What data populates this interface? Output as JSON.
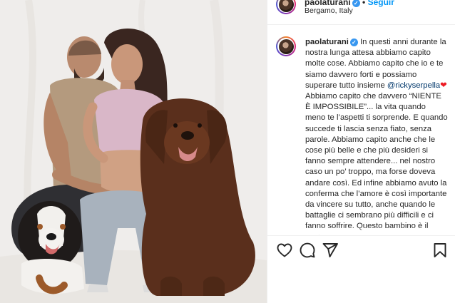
{
  "post": {
    "username": "paolaturani",
    "follow_label": "Seguir",
    "location": "Bergamo, Italy",
    "separator": "•",
    "verified_mark": "✓"
  },
  "caption": {
    "username": "paolaturani",
    "text_1": "In questi anni durante la nostra lunga attesa abbiamo capito molte cose. Abbiamo capito che io e te siamo davvero forti e possiamo superare tutto insieme ",
    "mention": "@rickyserpella",
    "heart": "❤",
    "text_2": " Abbiamo capito che davvero “NIENTE È IMPOSSIBILE”... la vita quando meno te l’aspetti ti sorprende. E quando succede ti lascia senza fiato, senza parole. Abbiamo capito anche che le cose più belle e che più desideri si fanno sempre attendere... nel nostro caso un po’ troppo, ma forse doveva andare così. Ed infine abbiamo avuto la conferma che l’amore è così importante da vincere su tutto, anche quando le battaglie ci sembrano più difficili e ci fanno soffrire. Questo bambino è il nostro"
  },
  "icons": {
    "like": "heart-icon",
    "comment": "comment-icon",
    "share": "share-icon",
    "save": "bookmark-icon"
  },
  "colors": {
    "accent": "#0095f6",
    "verified": "#3897f0",
    "text": "#262626",
    "mention": "#00376b",
    "border": "#efefef"
  }
}
